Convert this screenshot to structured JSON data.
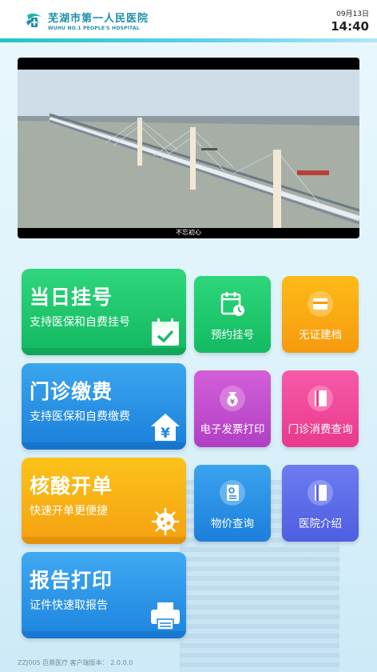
{
  "header": {
    "hospital_name_cn": "芜湖市第一人民医院",
    "hospital_name_en": "WUHU NO.1 PEOPLE'S HOSPITAL",
    "date": "09月13日",
    "time": "14:40",
    "logo_icon": "hospital-logo-icon"
  },
  "video": {
    "caption": "不忘初心",
    "scene_icon": "bridge-video-frame"
  },
  "big_cards": [
    {
      "title": "当日挂号",
      "subtitle": "支持医保和自费挂号",
      "icon": "calendar-check-icon",
      "color": "#16bd65"
    },
    {
      "title": "门诊缴费",
      "subtitle": "支持医保和自费缴费",
      "icon": "yuan-house-icon",
      "color": "#2089de"
    },
    {
      "title": "核酸开单",
      "subtitle": "快速开单更便捷",
      "icon": "virus-icon",
      "color": "#f7ab13"
    },
    {
      "title": "报告打印",
      "subtitle": "证件快速取报告",
      "icon": "printer-icon",
      "color": "#218bdf"
    }
  ],
  "small_cards": [
    {
      "label": "预约挂号",
      "icon": "calendar-clock-icon",
      "color": "#18c066"
    },
    {
      "label": "无证建档",
      "icon": "card-icon",
      "color": "#f8a40f"
    },
    {
      "label": "电子发票打印",
      "icon": "money-bag-icon",
      "color": "#bf4bcb"
    },
    {
      "label": "门诊消费查询",
      "icon": "book-icon",
      "color": "#ee4196"
    },
    {
      "label": "物价查询",
      "icon": "document-search-icon",
      "color": "#2388e0"
    },
    {
      "label": "医院介绍",
      "icon": "book-icon",
      "color": "#5a69e6"
    }
  ],
  "footer": {
    "text": "ZZJ005   巨鼎医疗  客户端版本： 2.0.0.0"
  }
}
